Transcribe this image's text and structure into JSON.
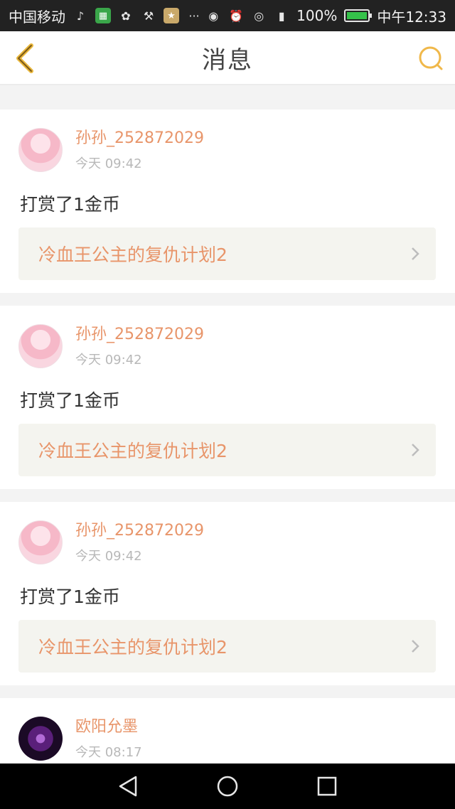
{
  "status_bar": {
    "carrier": "中国移动",
    "battery_percent": "100%",
    "time": "中午12:33",
    "icons": [
      "tiktok-icon",
      "app-green-icon",
      "app-flower-icon",
      "app-tool-icon",
      "app-star-icon",
      "more-icon",
      "hotspot-icon",
      "alarm-icon",
      "eye-icon",
      "signal-4g-icon",
      "battery-icon"
    ],
    "battery_level": 1.0
  },
  "header": {
    "title": "消息",
    "back_icon": "chevron-left-icon",
    "search_icon": "search-icon",
    "accent_color": "#f0b84a"
  },
  "messages": [
    {
      "username": "孙孙_252872029",
      "time": "今天 09:42",
      "text": "打赏了1金币",
      "book_title": "冷血王公主的复仇计划2",
      "avatar": "anime-girl-avatar"
    },
    {
      "username": "孙孙_252872029",
      "time": "今天 09:42",
      "text": "打赏了1金币",
      "book_title": "冷血王公主的复仇计划2",
      "avatar": "anime-girl-avatar"
    },
    {
      "username": "孙孙_252872029",
      "time": "今天 09:42",
      "text": "打赏了1金币",
      "book_title": "冷血王公主的复仇计划2",
      "avatar": "anime-girl-avatar"
    },
    {
      "username": "欧阳允墨",
      "time": "今天 08:17",
      "avatar": "purple-heart-avatar"
    }
  ],
  "nav_bar": {
    "icons": [
      "back-triangle-icon",
      "home-circle-icon",
      "recents-square-icon"
    ]
  },
  "colors": {
    "link": "#e8956a",
    "time": "#b8b8b8",
    "text": "#333333",
    "card_link_bg": "#f4f4ef"
  }
}
